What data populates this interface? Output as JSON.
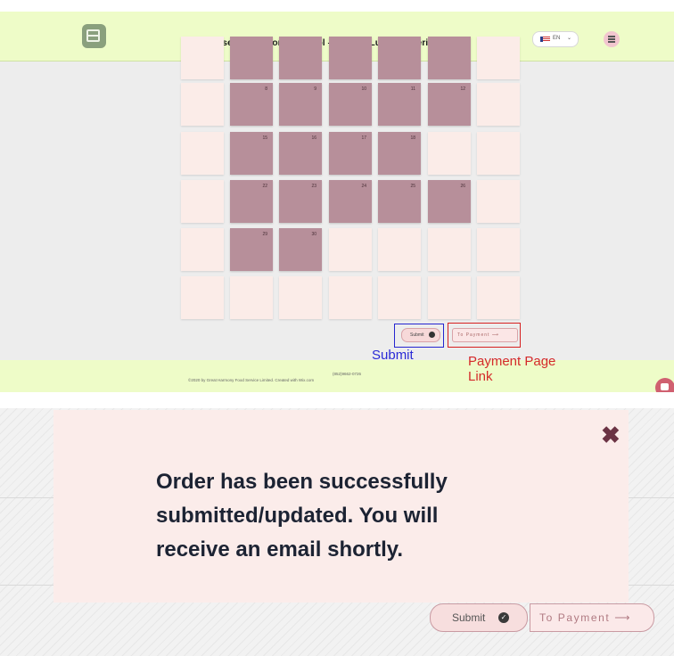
{
  "header": {
    "title": "Japanese International School – School Lunch Ordering Portal",
    "language_code": "EN",
    "language_chevron": "⌄"
  },
  "calendar": {
    "row2": [
      "8",
      "9",
      "10",
      "11",
      "12"
    ],
    "row3": [
      "15",
      "16",
      "17",
      "18"
    ],
    "row4": [
      "22",
      "23",
      "24",
      "25",
      "26"
    ],
    "row5": [
      "29",
      "30"
    ]
  },
  "actions": {
    "submit_label": "Submit",
    "payment_label": "To Payment ⟶"
  },
  "annotations": {
    "submit": "Submit",
    "payment_line1": "Payment Page",
    "payment_line2": "Link"
  },
  "footer": {
    "phone": "(852)9662-0726",
    "copyright": "©2020 by Great Harmony Food Service Limited. Created with Wix.com"
  },
  "dialog": {
    "close": "✖",
    "message_line1": "Order has been successfully",
    "message_line2": "submitted/updated. You will",
    "message_line3": "receive an email shortly.",
    "submit_label": "Submit",
    "payment_label": "To Payment ⟶"
  },
  "colors": {
    "header_bg": "#eefcc8",
    "filled_cell": "#b78f9a",
    "empty_cell": "#fbece8",
    "annotation_blue": "#2525d0",
    "annotation_red": "#d62020"
  }
}
